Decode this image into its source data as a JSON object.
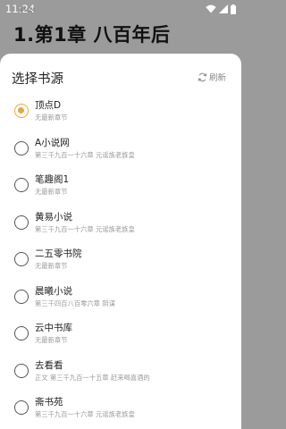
{
  "status_bar": {
    "time": "11:24",
    "ghost": "11:24",
    "icons": [
      "wifi-icon",
      "signal-icon",
      "battery-icon"
    ]
  },
  "reader": {
    "chapter_title": "1.第1章 八百年后"
  },
  "sheet": {
    "title": "选择书源",
    "refresh_label": "刷新",
    "refresh_icon": "refresh-icon"
  },
  "sources": [
    {
      "name": "顶点D",
      "latest": "无最新章节",
      "selected": true
    },
    {
      "name": "A小说网",
      "latest": "第三千九百一十六章 元谣族老族皇",
      "selected": false
    },
    {
      "name": "笔趣阁1",
      "latest": "无最新章节",
      "selected": false
    },
    {
      "name": "黄易小说",
      "latest": "第三千九百一十六章 元谣族老族皇",
      "selected": false
    },
    {
      "name": "二五零书院",
      "latest": "无最新章节",
      "selected": false
    },
    {
      "name": "晨曦小说",
      "latest": "第三千四百八百零六章 阴谋",
      "selected": false
    },
    {
      "name": "云中书库",
      "latest": "无最新章节",
      "selected": false
    },
    {
      "name": "去看看",
      "latest": "正文 第三千九百一十五章 赶来喝喜酒的",
      "selected": false
    },
    {
      "name": "斋书苑",
      "latest": "第三千九百一十六章 元谣族老族皇",
      "selected": false
    }
  ],
  "colors": {
    "accent": "#e6a93a",
    "overlay": "#9b9b9b"
  }
}
